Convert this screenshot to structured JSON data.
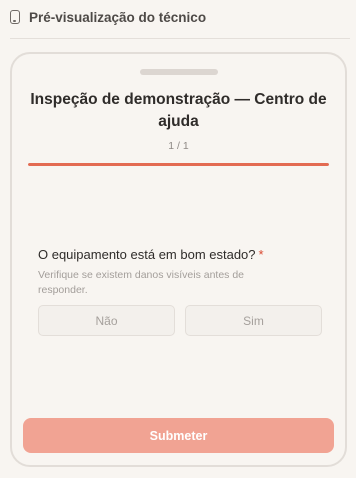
{
  "header": {
    "icon": "phone-icon",
    "title": "Pré-visualização do técnico"
  },
  "form": {
    "title": "Inspeção de demonstração — Centro de ajuda",
    "counter": "1 / 1",
    "progress_fraction": 1.0,
    "accent_color": "#e36b52"
  },
  "question": {
    "label": "O equipamento está em bom estado?",
    "required_marker": "*",
    "hint": "Verifique se existem danos visíveis antes de responder.",
    "options": [
      "Não",
      "Sim"
    ]
  },
  "submit": {
    "label": "Submeter",
    "color": "#f1a393"
  }
}
